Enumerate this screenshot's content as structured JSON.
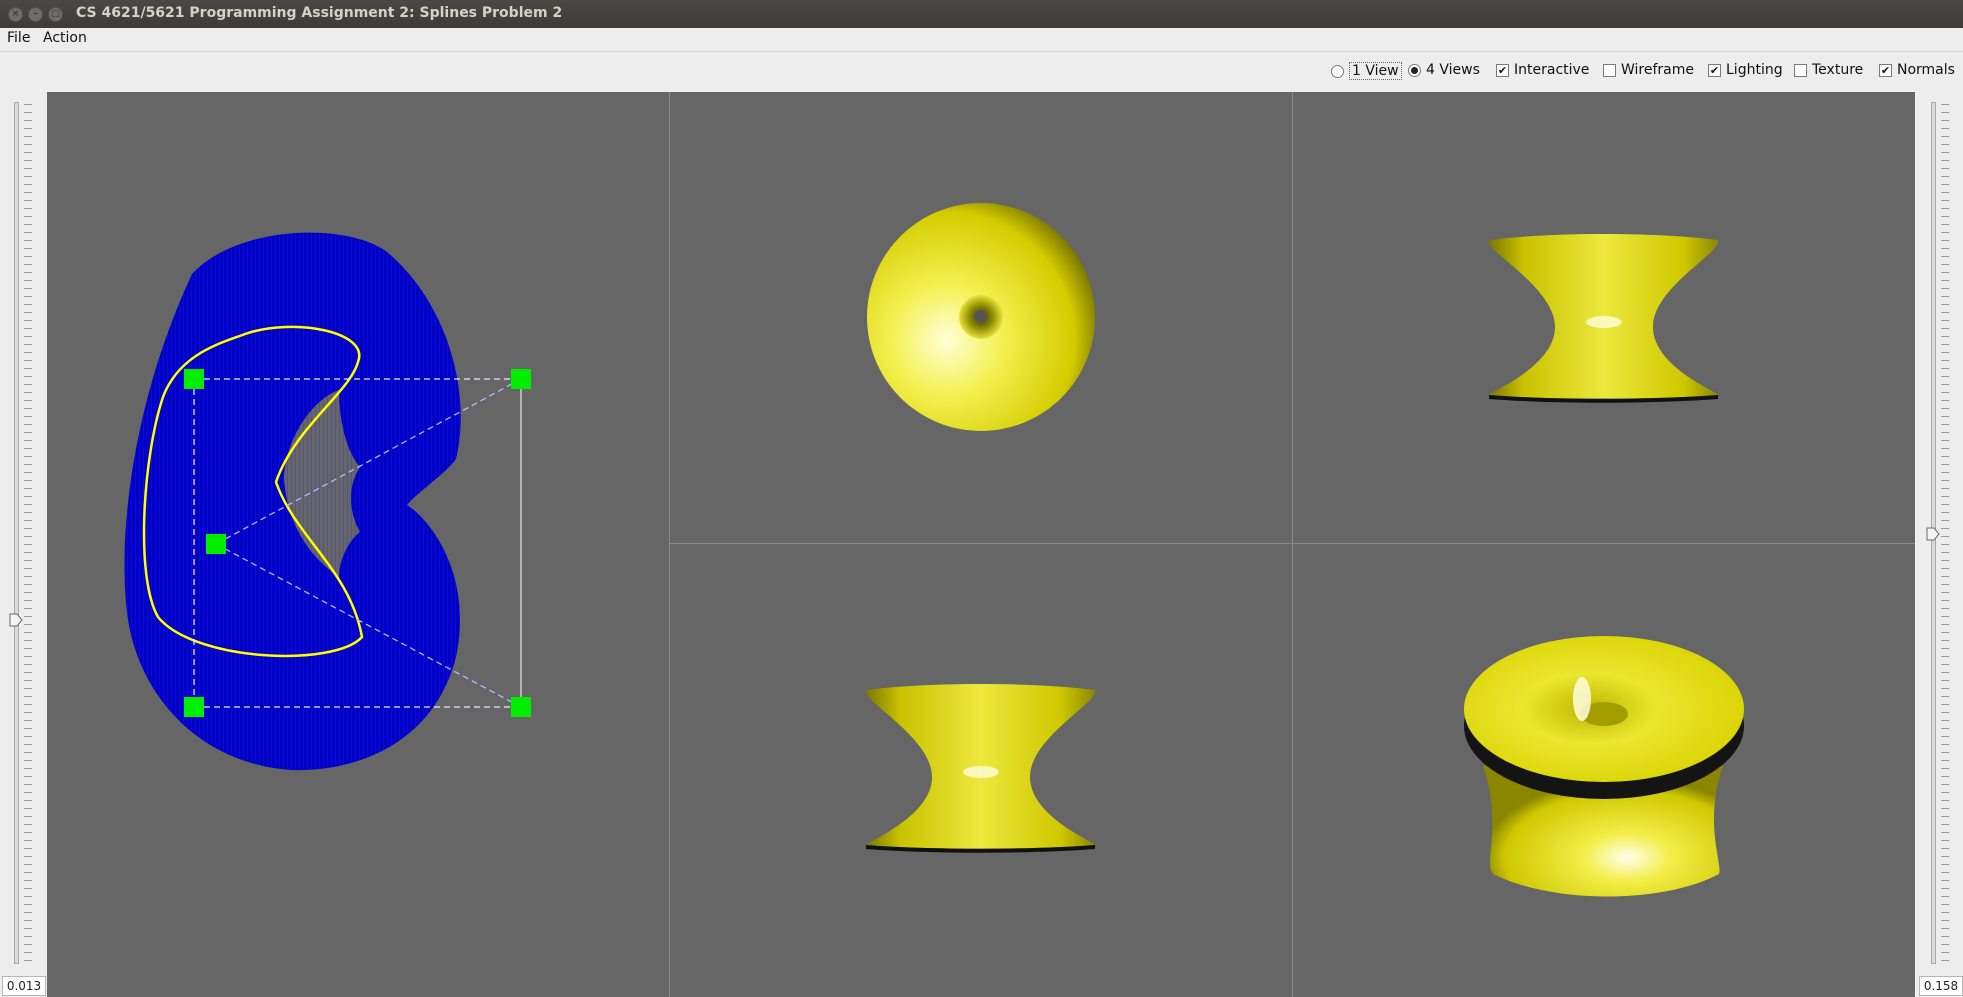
{
  "window": {
    "title": "CS 4621/5621 Programming Assignment 2: Splines Problem 2"
  },
  "menu": {
    "file": "File",
    "action": "Action"
  },
  "toolbar": {
    "one_view": "1 View",
    "four_views": "4 Views",
    "interactive": "Interactive",
    "wireframe": "Wireframe",
    "lighting": "Lighting",
    "texture": "Texture",
    "normals": "Normals",
    "selected_view": "4 Views",
    "interactive_checked": true,
    "wireframe_checked": false,
    "lighting_checked": true,
    "texture_checked": false,
    "normals_checked": true
  },
  "left_slider": {
    "value": "0.013"
  },
  "right_slider": {
    "value": "0.158"
  },
  "colors": {
    "viewport_bg": "#666666",
    "normals": "#0000c8",
    "curve": "#ffff00",
    "control_point": "#00ee00",
    "surface": "#e8e200"
  }
}
